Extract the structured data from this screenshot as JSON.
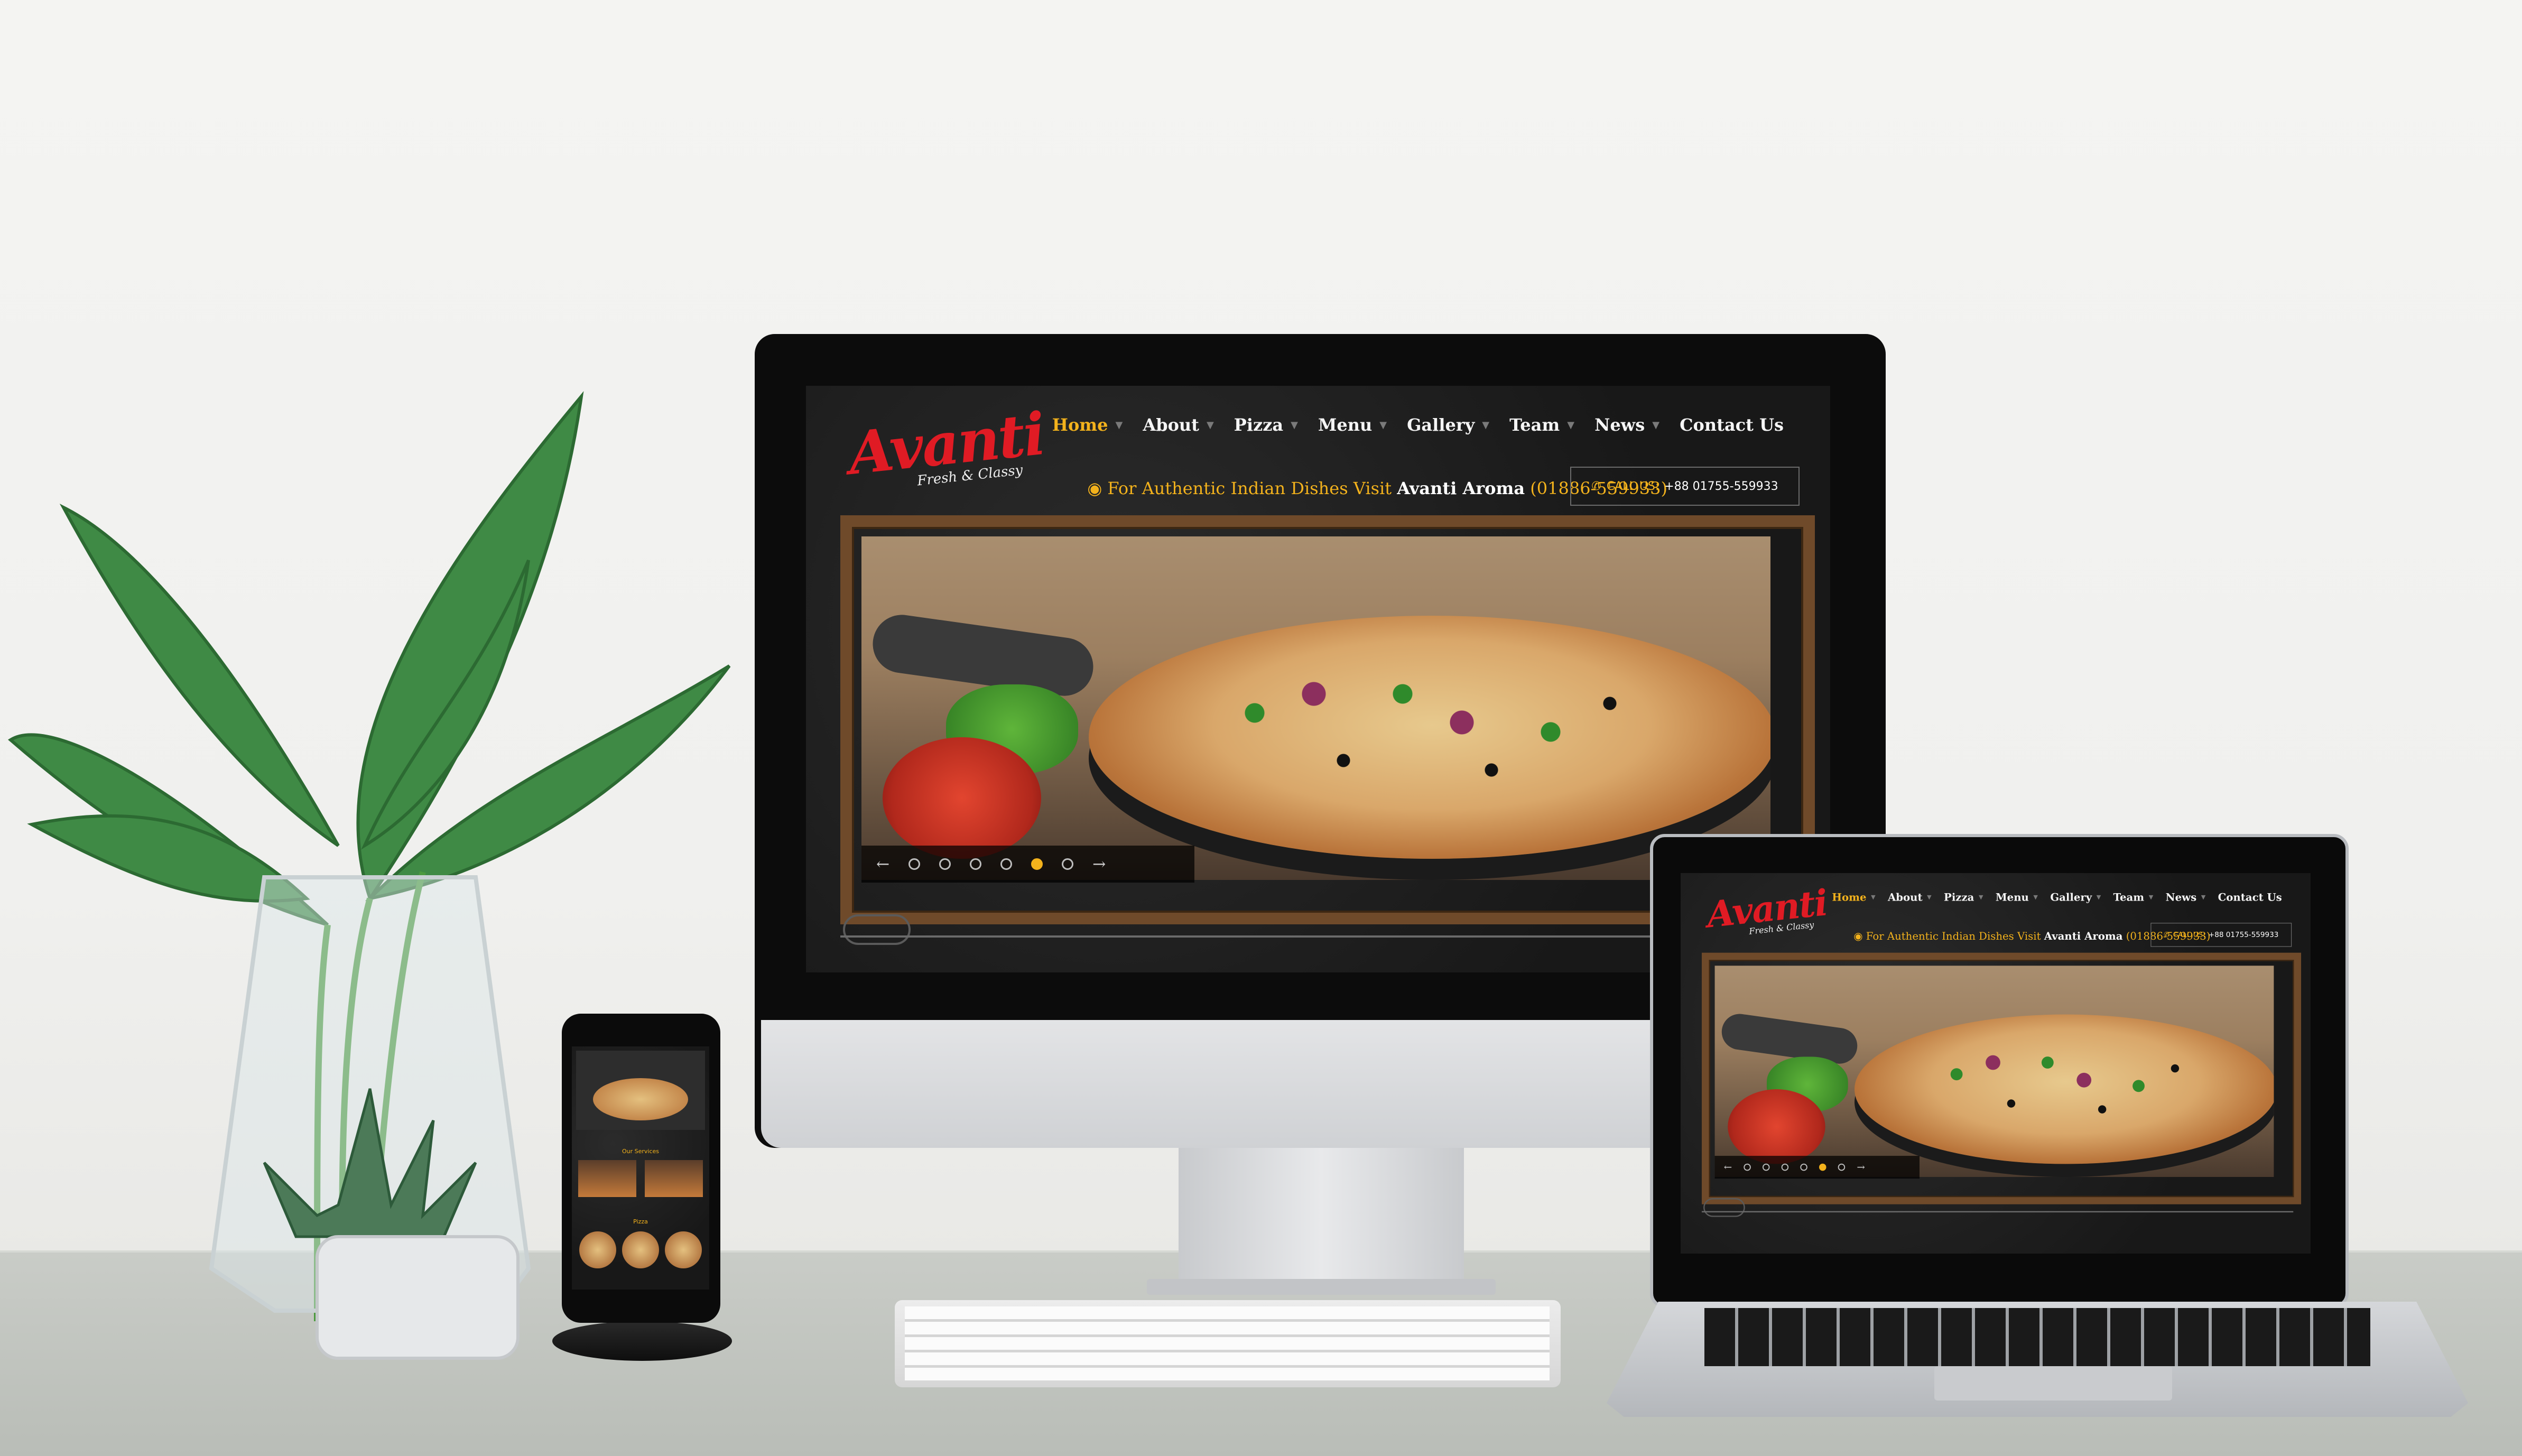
{
  "site": {
    "logo_text": "Avanti",
    "logo_tagline": "Fresh & Classy",
    "nav": [
      {
        "label": "Home",
        "active": true
      },
      {
        "label": "About",
        "active": false
      },
      {
        "label": "Pizza",
        "active": false
      },
      {
        "label": "Menu",
        "active": false
      },
      {
        "label": "Gallery",
        "active": false
      },
      {
        "label": "Team",
        "active": false
      },
      {
        "label": "News",
        "active": false
      },
      {
        "label": "Contact Us",
        "active": false
      }
    ],
    "info_prefix": "For Authentic Indian Dishes Visit",
    "info_brand": "Avanti Aroma",
    "info_phone": "(01886-559933)",
    "call_label": "CALL US:",
    "call_number": "+88 01755-559933",
    "slider": {
      "prev": "←",
      "next": "→",
      "dot_count": 6,
      "active_dot": 5
    }
  },
  "phone_site": {
    "section_services": "Our Services",
    "section_pizza": "Pizza"
  },
  "colors": {
    "accent": "#f3b21c",
    "brand_red": "#e01b24",
    "site_background": "#1d1d1d",
    "frame_wood": "#6f4a2a"
  },
  "icons": [
    "location-icon",
    "phone-icon",
    "chevron-down-icon",
    "arrow-left-icon",
    "arrow-right-icon"
  ]
}
